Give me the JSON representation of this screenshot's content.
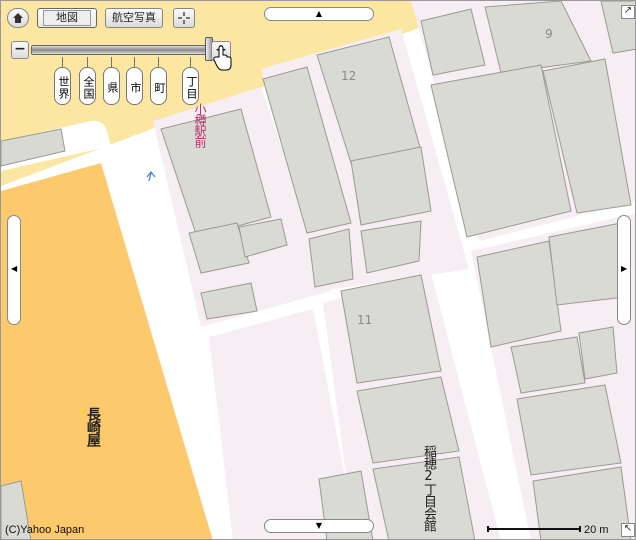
{
  "map": {
    "controls": {
      "home_icon": "home-icon",
      "map_label": "地図",
      "aerial_label": "航空写真",
      "crosshair_icon": "crosshair-icon",
      "zoom_out_label": "−",
      "zoom_in_label": "+",
      "pan_up": "▲",
      "pan_down": "▼",
      "pan_left": "◀",
      "pan_right": "▶"
    },
    "zoom_levels": [
      "世界",
      "全国",
      "県",
      "市",
      "町",
      "丁目"
    ],
    "labels": {
      "station": "小樽駅前",
      "store": "長崎屋",
      "hall": "稲穂2丁目会館",
      "block_9": "9",
      "block_12": "12",
      "block_11": "11"
    },
    "copyright": "(C)Yahoo Japan",
    "scale": "20 m",
    "colors": {
      "building": "#d9dad4",
      "building_edge": "#9a9a92",
      "commercial": "#fbe7a1",
      "department_store": "#fcc96c",
      "block_pink": "#f7eef4",
      "road": "#ffffff",
      "station_text": "#b8326a"
    }
  }
}
